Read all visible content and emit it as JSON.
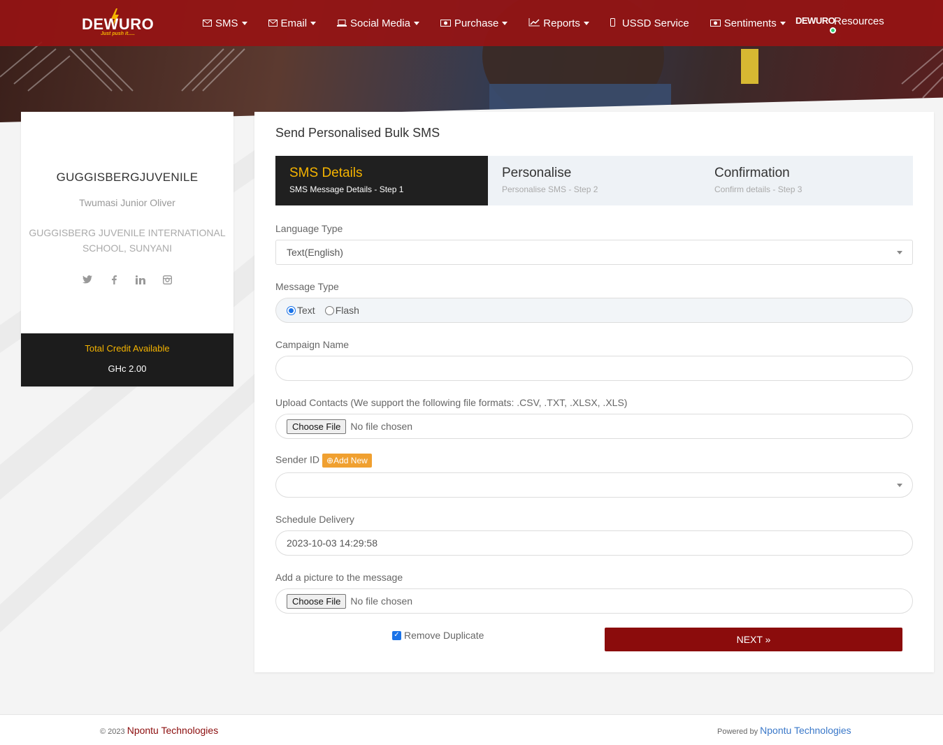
{
  "brand": {
    "name": "DEWURO",
    "tagline": "Just push it....."
  },
  "nav": {
    "items": [
      {
        "label": "SMS",
        "icon": "envelope-icon",
        "dropdown": true
      },
      {
        "label": "Email",
        "icon": "envelope-icon",
        "dropdown": true
      },
      {
        "label": "Social Media",
        "icon": "laptop-icon",
        "dropdown": true
      },
      {
        "label": "Purchase",
        "icon": "money-icon",
        "dropdown": true
      },
      {
        "label": "Reports",
        "icon": "line-chart-icon",
        "dropdown": true
      },
      {
        "label": "USSD Service",
        "icon": "mobile-icon",
        "dropdown": false
      },
      {
        "label": "Sentiments",
        "icon": "money-icon",
        "dropdown": true
      }
    ],
    "resources_logo": "DEWURO",
    "resources_label": "Resources"
  },
  "profile": {
    "username": "GUGGISBERGJUVENILE",
    "fullname": "Twumasi Junior Oliver",
    "school": "GUGGISBERG JUVENILE INTERNATIONAL SCHOOL, SUNYANI",
    "socials": [
      "twitter-icon",
      "facebook-icon",
      "linkedin-icon",
      "instagram-icon"
    ],
    "credit_label": "Total Credit Available",
    "credit_value": "GHc 2.00"
  },
  "panel": {
    "title": "Send Personalised Bulk SMS",
    "steps": [
      {
        "title": "SMS Details",
        "subtitle": "SMS Message Details - Step 1",
        "active": true
      },
      {
        "title": "Personalise",
        "subtitle": "Personalise SMS - Step 2",
        "active": false
      },
      {
        "title": "Confirmation",
        "subtitle": "Confirm details - Step 3",
        "active": false
      }
    ],
    "language_label": "Language Type",
    "language_value": "Text(English)",
    "message_type_label": "Message Type",
    "message_type_options": [
      "Text",
      "Flash"
    ],
    "message_type_selected": "Text",
    "campaign_label": "Campaign Name",
    "campaign_value": "",
    "upload_label": "Upload Contacts (We support the following file formats: .CSV, .TXT, .XLSX, .XLS)",
    "choose_file": "Choose File",
    "no_file": "No file chosen",
    "sender_label": "Sender ID",
    "add_new": "Add New",
    "sender_value": "",
    "schedule_label": "Schedule Delivery",
    "schedule_value": "2023-10-03 14:29:58",
    "picture_label": "Add a picture to the message",
    "remove_duplicate": "Remove Duplicate",
    "next": "NEXT »"
  },
  "footer": {
    "copyright": "© 2023",
    "company": "Npontu Technologies",
    "powered_by": "Powered by",
    "powered_company": "Npontu Technologies"
  },
  "colors": {
    "accent": "#8b0c0c",
    "navbar": "#961414",
    "gold": "#f5b400",
    "link": "#3a78c9"
  }
}
